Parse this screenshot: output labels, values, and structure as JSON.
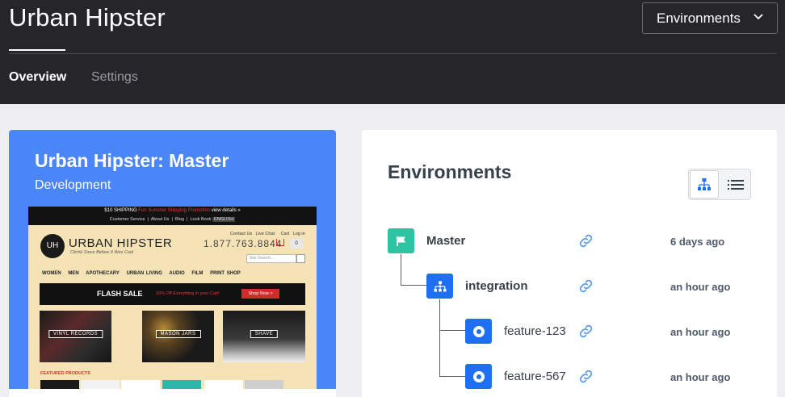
{
  "header": {
    "title": "Urban Hipster",
    "env_dropdown_label": "Environments",
    "tabs": [
      {
        "label": "Overview",
        "active": true
      },
      {
        "label": "Settings",
        "active": false
      }
    ]
  },
  "project_card": {
    "title": "Urban Hipster: Master",
    "subtitle": "Development",
    "accent_color": "#4a86f7",
    "preview": {
      "shipping_text": "$10 SHIPPING",
      "shipping_red": "Fun Summer Shipping Promotion",
      "shipping_details": "view details »",
      "top_links": [
        "Customer Service",
        "About Us",
        "Blog",
        "Look Book"
      ],
      "language": "ENGLISH",
      "logo_initials": "UH",
      "brand": "URBAN HIPSTER",
      "tagline": "Cliché Since Before It Was Cool",
      "contact_links": [
        "Contact Us",
        "Live Chat",
        "Cart",
        "Log in"
      ],
      "phone": "1.877.763.8844",
      "cart_count": "0",
      "search_placeholder": "Site Search...",
      "nav": [
        "WOMEN",
        "MEN",
        "APOTHECARY",
        "URBAN LIVING",
        "AUDIO",
        "FILM",
        "PRINT SHOP"
      ],
      "flash_title": "FLASH SALE",
      "flash_text": "20% Off Everything in your Cart!",
      "flash_button": "Shop Now >",
      "categories": [
        "VINYL RECORDS",
        "MASON JARS",
        "SHAVE"
      ],
      "featured_label": "FEATURED PRODUCTS"
    }
  },
  "environments": {
    "heading": "Environments",
    "view_modes": [
      {
        "icon": "tree-view-icon",
        "active": true
      },
      {
        "icon": "list-view-icon",
        "active": false
      }
    ],
    "items": [
      {
        "name": "Master",
        "time": "6 days ago",
        "icon": "flag-icon",
        "color": "#2ec4a0",
        "level": 0
      },
      {
        "name": "integration",
        "time": "an hour ago",
        "icon": "hierarchy-icon",
        "color": "#1f6ff2",
        "level": 1
      },
      {
        "name": "feature-123",
        "time": "an hour ago",
        "icon": "circle-dot-icon",
        "color": "#1f6ff2",
        "level": 2
      },
      {
        "name": "feature-567",
        "time": "an hour ago",
        "icon": "circle-dot-icon",
        "color": "#1f6ff2",
        "level": 2
      }
    ]
  }
}
